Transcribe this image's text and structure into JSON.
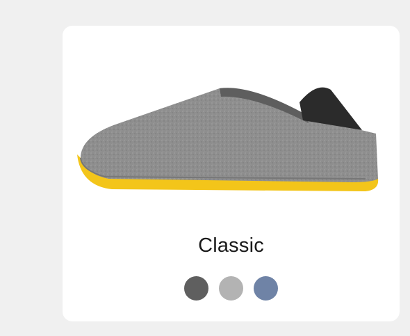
{
  "product": {
    "name": "Classic",
    "image_alt": "shoe-image",
    "colors": {
      "felt": "#8e8e8e",
      "sole": "#f3c51a",
      "heel": "#2b2b2b"
    },
    "swatches": [
      {
        "label": "dark-grey",
        "color": "#5f5f5f"
      },
      {
        "label": "light-grey",
        "color": "#b3b3b3"
      },
      {
        "label": "blue-grey",
        "color": "#6f83a6"
      }
    ]
  }
}
